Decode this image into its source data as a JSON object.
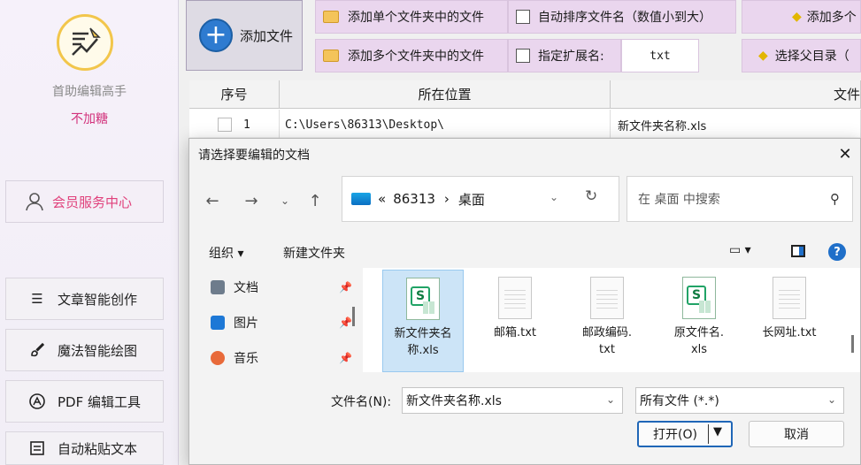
{
  "sidebar": {
    "app_title": "首助编辑高手",
    "app_subtitle": "不加糖",
    "member_label": "会员服务中心",
    "nav": [
      {
        "label": "文章智能创作",
        "icon": "list-icon"
      },
      {
        "label": "魔法智能绘图",
        "icon": "brush-icon"
      },
      {
        "label": "PDF 编辑工具",
        "icon": "pdf-icon"
      },
      {
        "label": "自动粘贴文本",
        "icon": "paste-icon"
      }
    ]
  },
  "toolbar": {
    "add_file": "添加文件",
    "add_single_folder": "添加单个文件夹中的文件",
    "add_multi_folder": "添加多个文件夹中的文件",
    "auto_sort": "自动排序文件名（数值小到大）",
    "specify_ext": "指定扩展名:",
    "ext_value": "txt",
    "add_other": "添加多个",
    "choose_parent": "选择父目录（"
  },
  "grid": {
    "headers": [
      "序号",
      "所在位置",
      "文件"
    ],
    "rows": [
      {
        "index": "1",
        "location": "C:\\Users\\86313\\Desktop\\",
        "name": "新文件夹名称.xls"
      }
    ]
  },
  "dialog": {
    "title": "请选择要编辑的文档",
    "breadcrumb": [
      "«",
      "86313",
      "›",
      "桌面"
    ],
    "search_placeholder": "在 桌面 中搜索",
    "organize": "组织 ▾",
    "new_folder": "新建文件夹",
    "nav_items": [
      "文档",
      "图片",
      "音乐"
    ],
    "files": [
      {
        "name": "新文件夹名\n称.xls",
        "type": "xls",
        "selected": true
      },
      {
        "name": "邮箱.txt",
        "type": "txt",
        "selected": false
      },
      {
        "name": "邮政编码.\ntxt",
        "type": "txt",
        "selected": false
      },
      {
        "name": "原文件名.\nxls",
        "type": "xls",
        "selected": false
      },
      {
        "name": "长网址.txt",
        "type": "txt",
        "selected": false
      }
    ],
    "filename_label": "文件名(N):",
    "filename_value": "新文件夹名称.xls",
    "filetype_value": "所有文件 (*.*)",
    "open_label": "打开(O)",
    "cancel_label": "取消"
  }
}
